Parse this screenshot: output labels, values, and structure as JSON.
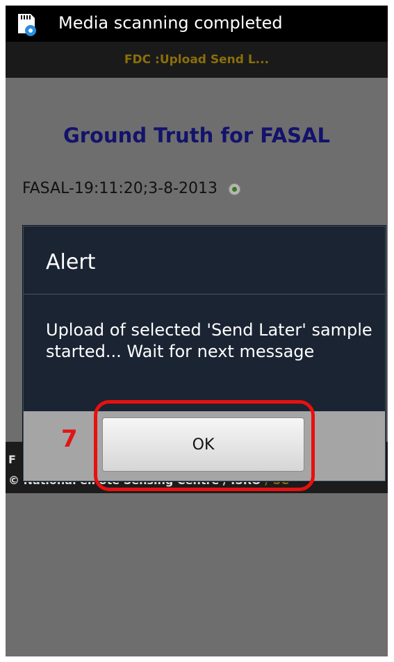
{
  "status_bar": {
    "notification_text": "Media scanning completed",
    "icon": "sd-card-settings-icon"
  },
  "title_bar": {
    "title": "FDC :Upload Send L..."
  },
  "main": {
    "heading": "Ground Truth for FASAL",
    "sample_label": "FASAL-19:11:20;3-8-2013",
    "sample_selected": true
  },
  "footer": {
    "line1": "F",
    "line2_left": "© National ",
    "line2_middle": "emote Sensing Centre / ISRO ",
    "line2_accent": "/ SC"
  },
  "dialog": {
    "title": "Alert",
    "message": " Upload of selected 'Send Later' sample started... Wait for next message",
    "ok_label": "OK"
  },
  "annotation": {
    "step_number": "7",
    "color": "#e81010"
  },
  "colors": {
    "dim_background": "#6e6e6e",
    "heading": "#13136b",
    "title_accent": "#8a6f0a",
    "dialog_bg": "#1b2433"
  }
}
